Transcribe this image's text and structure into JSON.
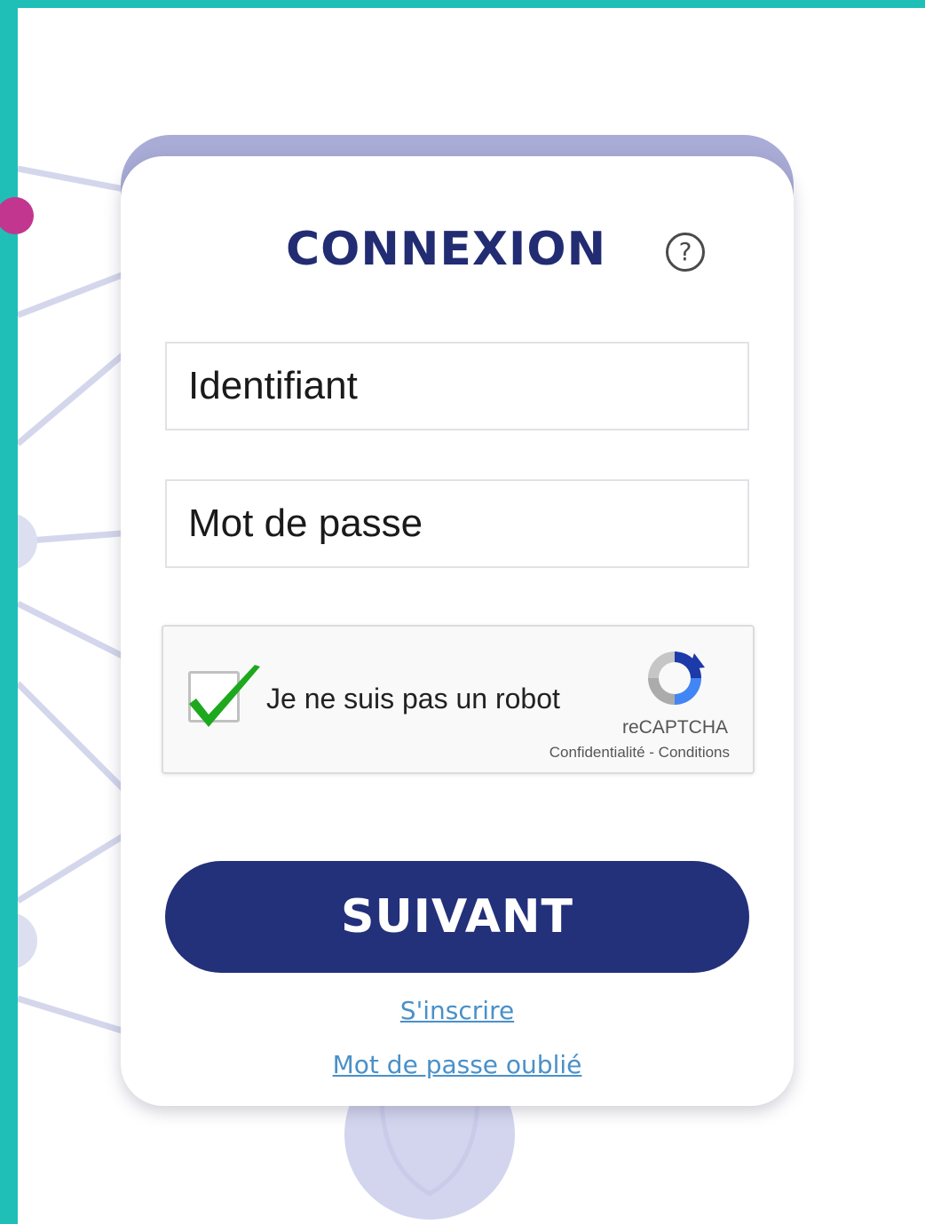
{
  "login": {
    "title": "CONNEXION",
    "help_icon": "help-circle-icon",
    "username_placeholder": "Identifiant",
    "password_placeholder": "Mot de passe",
    "submit_label": "SUIVANT",
    "signup_link": "S'inscrire",
    "forgot_password_link": "Mot de passe oublié"
  },
  "recaptcha": {
    "checked": true,
    "label": "Je ne suis pas un robot",
    "brand": "reCAPTCHA",
    "privacy": "Confidentialité",
    "separator": "-",
    "terms": "Conditions",
    "logo_icon": "recaptcha-logo-icon",
    "check_icon": "green-checkmark-icon"
  },
  "colors": {
    "frame": "#1fbfb8",
    "accent_dot": "#c2368f",
    "card_accent": "#a9acd6",
    "title": "#222c72",
    "button": "#23307a",
    "link": "#4a90c8",
    "check": "#1ea81e"
  }
}
